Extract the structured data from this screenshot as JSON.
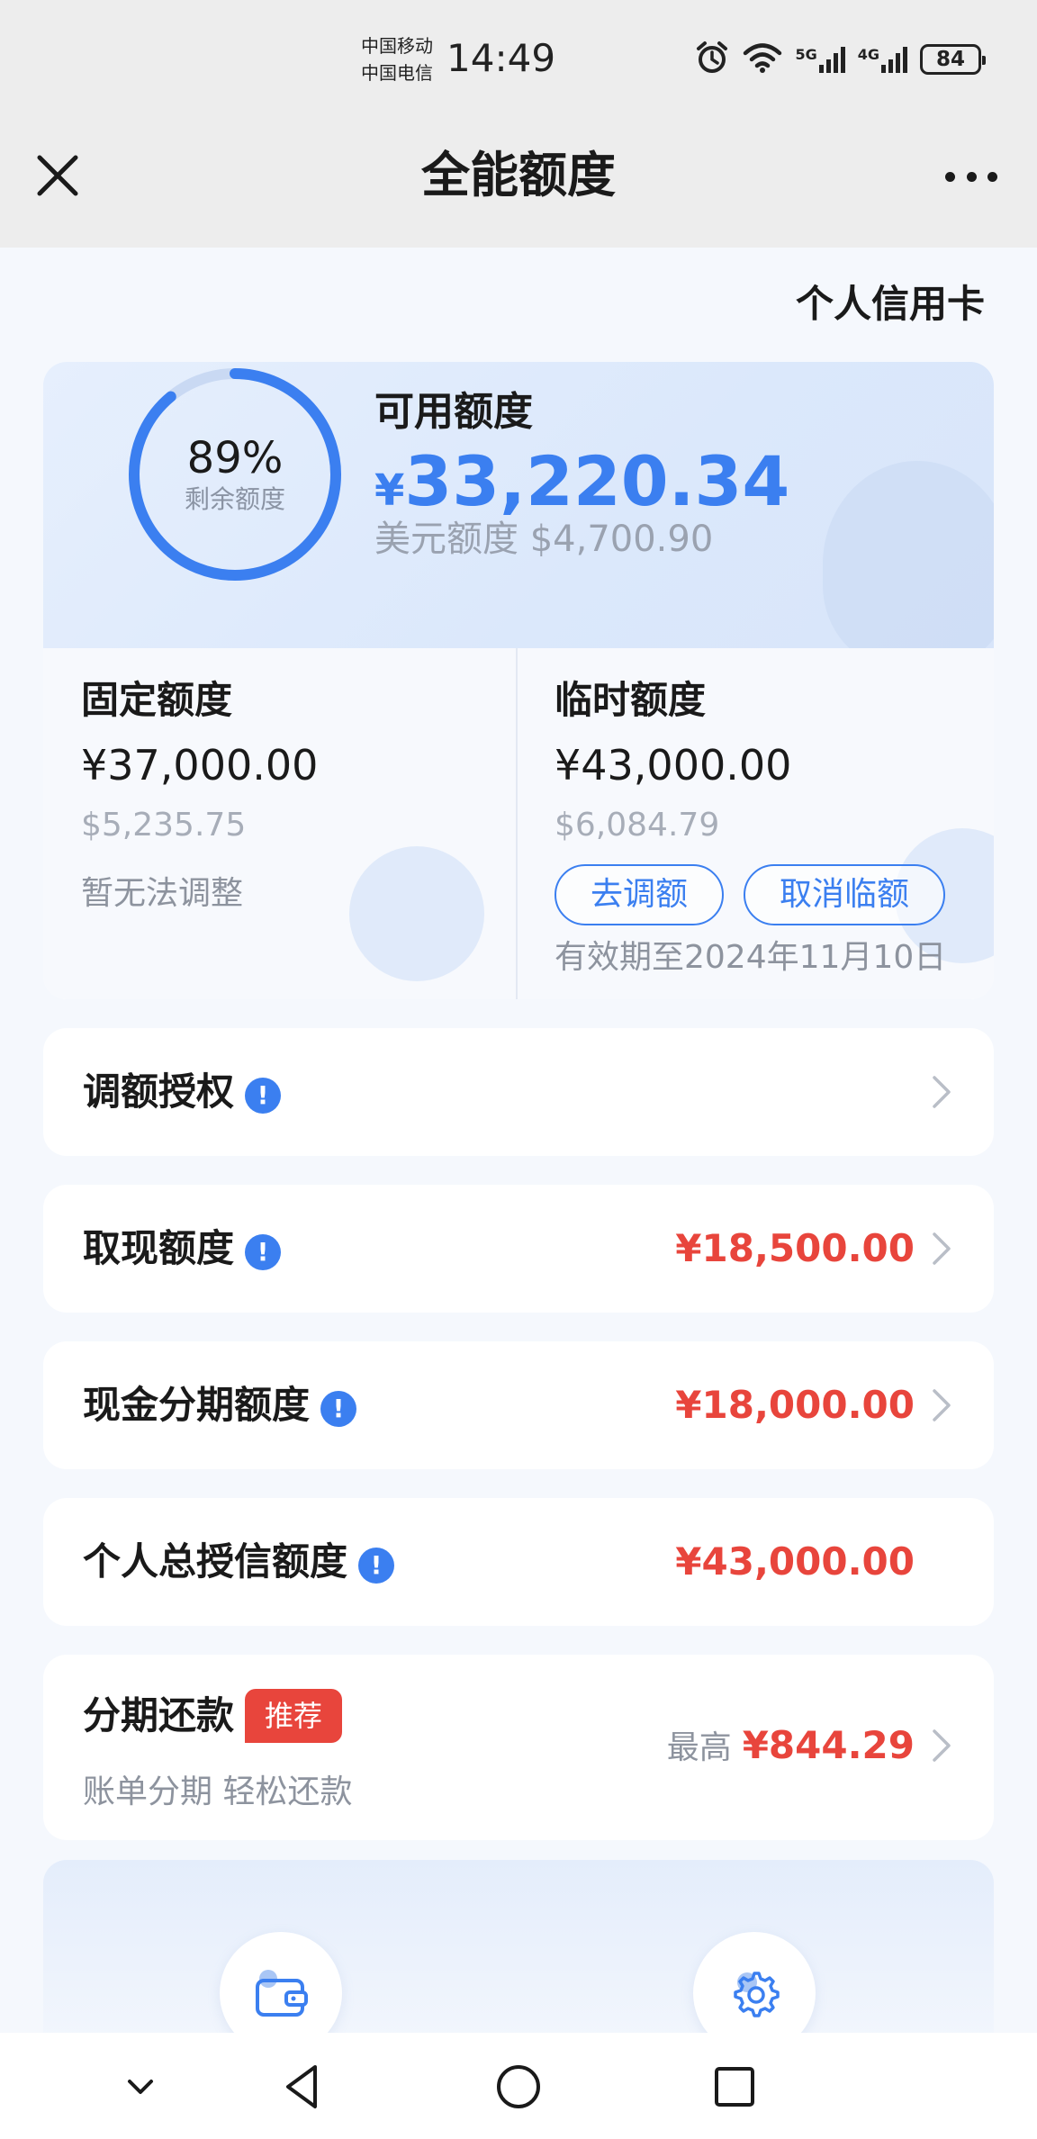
{
  "status_bar": {
    "carrier1": "中国移动",
    "carrier2": "中国电信",
    "time": "14:49",
    "net1": "5G",
    "net2": "4G",
    "battery": "84"
  },
  "header": {
    "title": "全能额度"
  },
  "card_type": "个人信用卡",
  "credit": {
    "percent": "89%",
    "percent_value": 0.89,
    "percent_label": "剩余额度",
    "available_label": "可用额度",
    "available_currency": "¥",
    "available_amount": "33,220.34",
    "usd_line": "美元额度 $4,700.90",
    "fixed": {
      "title": "固定额度",
      "amount": "¥37,000.00",
      "usd": "$5,235.75",
      "note": "暂无法调整"
    },
    "temp": {
      "title": "临时额度",
      "amount": "¥43,000.00",
      "usd": "$6,084.79",
      "adjust_button": "去调额",
      "cancel_button": "取消临额",
      "expiry": "有效期至2024年11月10日"
    }
  },
  "rows": {
    "authorize": {
      "label": "调额授权"
    },
    "cash": {
      "label": "取现额度",
      "value": "¥18,500.00"
    },
    "installment_cash": {
      "label": "现金分期额度",
      "value": "¥18,000.00"
    },
    "total": {
      "label": "个人总授信额度",
      "value": "¥43,000.00"
    },
    "installment_repay": {
      "label": "分期还款",
      "badge": "推荐",
      "sub": "账单分期 轻松还款",
      "prefix": "最高",
      "value": "¥844.29"
    }
  },
  "colors": {
    "accent": "#3b7ff0",
    "amount_red": "#e8453c"
  },
  "icons": {
    "info": "!"
  }
}
